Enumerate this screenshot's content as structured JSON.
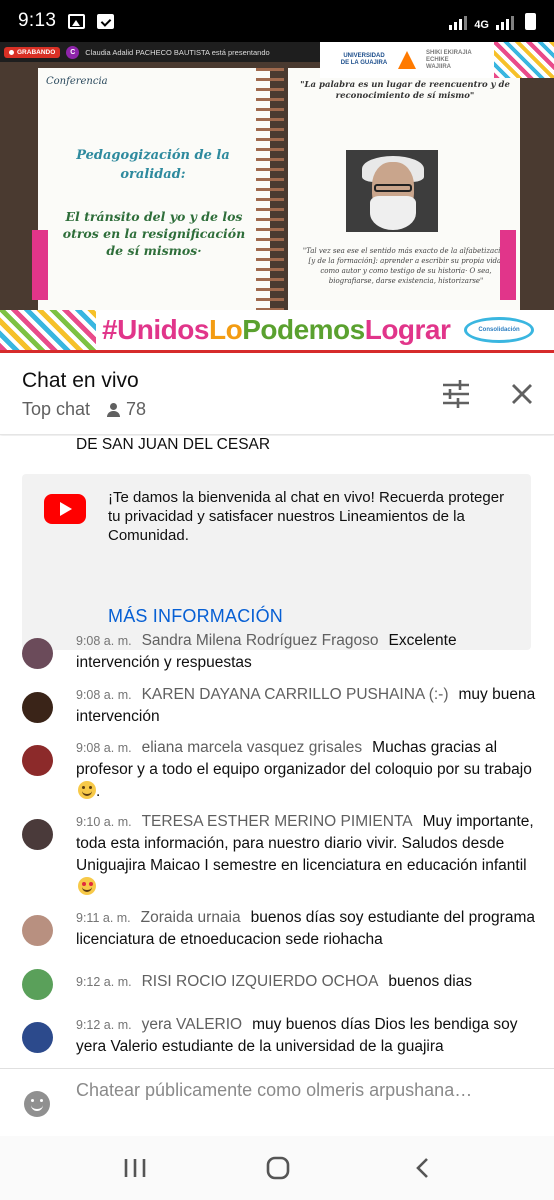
{
  "status_bar": {
    "time": "9:13",
    "network": "4G"
  },
  "video": {
    "recording_badge": "GRABANDO",
    "presenter_initial": "C",
    "presenter_notice": "Claudia Adalid PACHECO BAUTISTA está presentando",
    "university": "UNIVERSIDAD DE LA GUAJIRA",
    "university_motto": "SHIKI EKIRAJIA ECHIKE WAJIIRA",
    "slide_label": "Conferencia",
    "slide_title": "Pedagogización de la oralidad:",
    "slide_subtitle": "El tránsito del yo y de los otros en la resignificación de sí mismos·",
    "quote_top": "\"La palabra es un lugar de reencuentro y de reconocimiento de sí mismo\"",
    "quote_body": "\"Tal vez sea ese el sentido más exacto de la alfabetización [y de la formación]: aprender a escribir su propia vida, como autor y como testigo de su historia· O sea, biografiarse, darse existencia, historizarse\"",
    "hashtag_parts": [
      "#Unidos",
      "Lo",
      "Podemos",
      "Lograr"
    ],
    "seal_text": "Consolidación"
  },
  "chat_header": {
    "title": "Chat en vivo",
    "mode": "Top chat",
    "viewers": "78"
  },
  "chat": {
    "previous_text": "DE SAN JUAN DEL CESAR",
    "welcome_message": "¡Te damos la bienvenida al chat en vivo! Recuerda proteger tu privacidad y satisfacer nuestros Lineamientos de la Comunidad.",
    "more_info_label": "MÁS INFORMACIÓN",
    "messages": [
      {
        "time": "9:08 a. m.",
        "author": "Sandra Milena Rodríguez Fragoso",
        "text": "Excelente intervención y respuestas",
        "avatar_color": "#6b4b5a"
      },
      {
        "time": "9:08 a. m.",
        "author": "KAREN DAYANA CARRILLO PUSHAINA (:-)",
        "text": "muy buena intervención",
        "avatar_color": "#3a2418"
      },
      {
        "time": "9:08 a. m.",
        "author": "eliana marcela vasquez grisales",
        "text": "Muchas gracias al profesor y a todo el equipo organizador del coloquio por su trabajo",
        "emoji": "slightly-smiling-face",
        "text_after": ".",
        "avatar_color": "#8c2a2a"
      },
      {
        "time": "9:10 a. m.",
        "author": "TERESA ESTHER MERINO PIMIENTA",
        "text": "Muy importante, toda esta información, para nuestro diario vivir. Saludos desde Uniguajira Maicao I semestre en licenciatura en educación infantil",
        "emoji": "heart-eyes",
        "avatar_color": "#4a3a3a"
      },
      {
        "time": "9:11 a. m.",
        "author": "Zoraida urnaia",
        "text": "buenos días soy estudiante del programa licenciatura de etnoeducacion sede riohacha",
        "avatar_color": "#b89080"
      },
      {
        "time": "9:12 a. m.",
        "author": "RISI ROCIO IZQUIERDO OCHOA",
        "text": "buenos dias",
        "avatar_color": "#5aa05a"
      },
      {
        "time": "9:12 a. m.",
        "author": "yera VALERIO",
        "text": "muy buenos días Dios les bendiga soy yera Valerio estudiante de la universidad de la guajira",
        "avatar_color": "#2c4a8c"
      }
    ]
  },
  "input": {
    "placeholder": "Chatear públicamente como olmeris arpushana…"
  },
  "colors": {
    "link_blue": "#065fd4",
    "youtube_red": "#ff0000",
    "divider_red": "#d62b2b"
  }
}
